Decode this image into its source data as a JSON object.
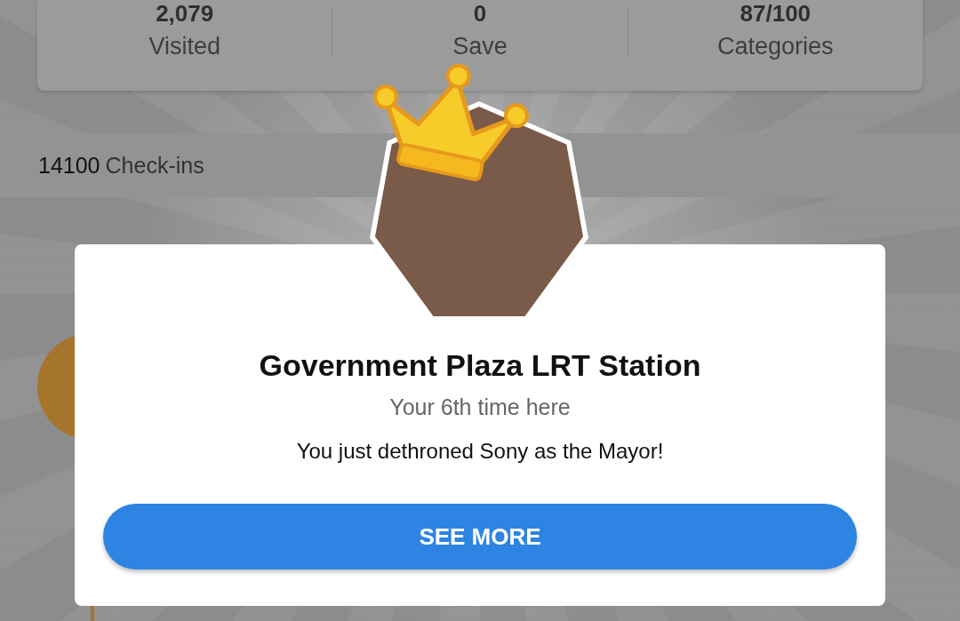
{
  "stats": [
    {
      "value": "2,079",
      "label": "Visited"
    },
    {
      "value": "0",
      "label": "Save"
    },
    {
      "value": "87/100",
      "label": "Categories"
    }
  ],
  "checkins": {
    "count": "14100",
    "label": "Check-ins"
  },
  "dialog": {
    "venue": "Government Plaza LRT Station",
    "visit_count": "Your 6th time here",
    "message": "You just dethroned Sony as the Mayor!",
    "button": "SEE MORE"
  }
}
